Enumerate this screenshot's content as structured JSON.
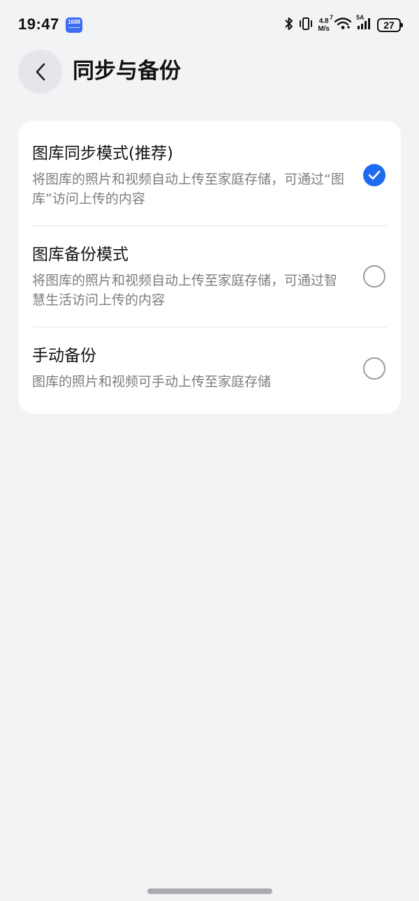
{
  "status_bar": {
    "time": "19:47",
    "app_badge": "1688",
    "net_speed_value": "4.8",
    "net_speed_unit": "M/s",
    "wifi_label": "7",
    "cell_label": "5A",
    "battery": "27"
  },
  "header": {
    "title": "同步与备份"
  },
  "options": [
    {
      "title": "图库同步模式(推荐)",
      "desc": "将图库的照片和视频自动上传至家庭存储，可通过“图库”访问上传的内容",
      "selected": true
    },
    {
      "title": "图库备份模式",
      "desc": "将图库的照片和视频自动上传至家庭存储，可通过智慧生活访问上传的内容",
      "selected": false
    },
    {
      "title": "手动备份",
      "desc": "图库的照片和视频可手动上传至家庭存储",
      "selected": false
    }
  ],
  "colors": {
    "accent": "#1f6bf0",
    "background": "#f1f3f5",
    "card": "#ffffff"
  },
  "icons": {
    "back": "chevron-left-icon",
    "selected": "checkmark-circle-icon",
    "unselected": "radio-empty-icon"
  }
}
